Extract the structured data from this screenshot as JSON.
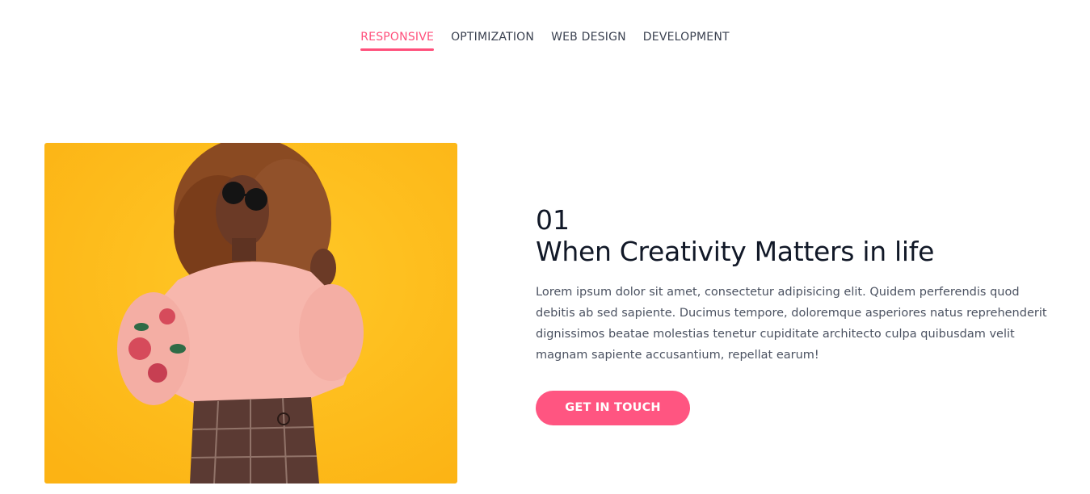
{
  "tabs": [
    {
      "label": "RESPONSIVE",
      "active": true
    },
    {
      "label": "OPTIMIZATION",
      "active": false
    },
    {
      "label": "WEB DESIGN",
      "active": false
    },
    {
      "label": "DEVELOPMENT",
      "active": false
    }
  ],
  "feature": {
    "number": "01",
    "title": "When Creativity Matters in life",
    "description": "Lorem ipsum dolor sit amet, consectetur adipisicing elit. Quidem perferendis quod debitis ab sed sapiente. Ducimus tempore, doloremque asperiores natus reprehenderit dignissimos beatae molestias tenetur cupiditate architecto culpa quibusdam velit magnam sapiente accusantium, repellat earum!",
    "cta_label": "GET IN TOUCH"
  },
  "colors": {
    "accent": "#ff5581",
    "photo_background": "#fdbd1c"
  }
}
